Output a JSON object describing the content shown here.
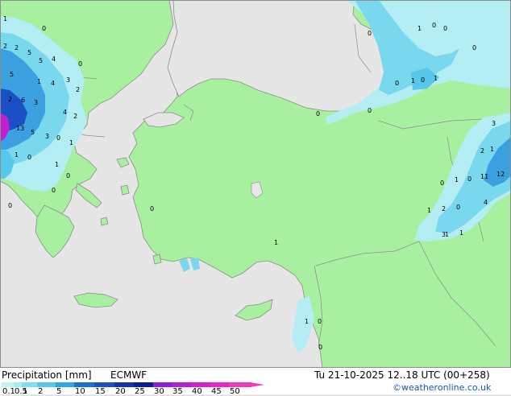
{
  "footer": {
    "product": "Precipitation [mm]",
    "model": "ECMWF",
    "valid_time": "Tu 21-10-2025 12..18 UTC (00+258)",
    "credit": "©weatheronline.co.uk"
  },
  "legend": {
    "levels": [
      "0.1",
      "0.5",
      "1",
      "2",
      "5",
      "10",
      "15",
      "20",
      "25",
      "30",
      "35",
      "40",
      "45",
      "50"
    ],
    "colors": [
      "#c6f4f6",
      "#a6ecf2",
      "#80def0",
      "#55c8ec",
      "#2fa8e0",
      "#1870d4",
      "#1b4fc6",
      "#1530b0",
      "#0a1c9e",
      "#8a1fe0",
      "#b21fd8",
      "#d61fd0",
      "#ee24c8",
      "#f03ab8"
    ]
  },
  "colors": {
    "sea": "#e6e6e6",
    "land": "#a8f0a0",
    "border": "#8c8c8c",
    "precip_light": "#b4eef4",
    "precip_mid": "#7ad8ee",
    "precip_heavy": "#3aa0e0",
    "precip_extreme": "#c020d0"
  },
  "precip_values": [
    {
      "id": "v1",
      "label": "1"
    },
    {
      "id": "v2",
      "label": "0"
    },
    {
      "id": "v3",
      "label": "2"
    },
    {
      "id": "v4",
      "label": "2"
    },
    {
      "id": "v5",
      "label": "5"
    },
    {
      "id": "v6",
      "label": "5"
    },
    {
      "id": "v7",
      "label": "3"
    },
    {
      "id": "v8",
      "label": "0"
    },
    {
      "id": "v9",
      "label": "5"
    },
    {
      "id": "v10",
      "label": "4"
    },
    {
      "id": "v11",
      "label": "1"
    },
    {
      "id": "v12",
      "label": "4"
    },
    {
      "id": "v13",
      "label": "2"
    },
    {
      "id": "v14",
      "label": "2"
    },
    {
      "id": "v15",
      "label": "6"
    },
    {
      "id": "v16",
      "label": "3"
    },
    {
      "id": "v17",
      "label": "4"
    },
    {
      "id": "v18",
      "label": "2"
    },
    {
      "id": "v19",
      "label": "13"
    },
    {
      "id": "v20",
      "label": "5"
    },
    {
      "id": "v21",
      "label": "3"
    },
    {
      "id": "v22",
      "label": "0"
    },
    {
      "id": "v23",
      "label": "1"
    },
    {
      "id": "v24",
      "label": "1"
    },
    {
      "id": "v25",
      "label": "0"
    },
    {
      "id": "v26",
      "label": "1"
    },
    {
      "id": "v27",
      "label": "0"
    },
    {
      "id": "v28",
      "label": "0"
    },
    {
      "id": "v29",
      "label": "0"
    },
    {
      "id": "v30",
      "label": "0"
    },
    {
      "id": "v31",
      "label": "1"
    },
    {
      "id": "v32",
      "label": "0"
    },
    {
      "id": "v33",
      "label": "0"
    },
    {
      "id": "v34",
      "label": "0"
    },
    {
      "id": "v35",
      "label": "1"
    },
    {
      "id": "v36",
      "label": "0"
    },
    {
      "id": "v37",
      "label": "1"
    },
    {
      "id": "v38",
      "label": "0"
    },
    {
      "id": "v39",
      "label": "0"
    },
    {
      "id": "v40",
      "label": "0"
    },
    {
      "id": "v41",
      "label": "3"
    },
    {
      "id": "v42",
      "label": "2"
    },
    {
      "id": "v43",
      "label": "1"
    },
    {
      "id": "v44",
      "label": "11"
    },
    {
      "id": "v45",
      "label": "12"
    },
    {
      "id": "v46",
      "label": "0"
    },
    {
      "id": "v47",
      "label": "1"
    },
    {
      "id": "v48",
      "label": "0"
    },
    {
      "id": "v49",
      "label": "1"
    },
    {
      "id": "v50",
      "label": "2"
    },
    {
      "id": "v51",
      "label": "0"
    },
    {
      "id": "v52",
      "label": "4"
    },
    {
      "id": "v53",
      "label": "1"
    },
    {
      "id": "v54",
      "label": "1"
    },
    {
      "id": "v55",
      "label": "3"
    },
    {
      "id": "v56",
      "label": "1"
    },
    {
      "id": "v57",
      "label": "0"
    },
    {
      "id": "v58",
      "label": "1"
    },
    {
      "id": "v59",
      "label": "0"
    },
    {
      "id": "v60",
      "label": "0"
    }
  ]
}
